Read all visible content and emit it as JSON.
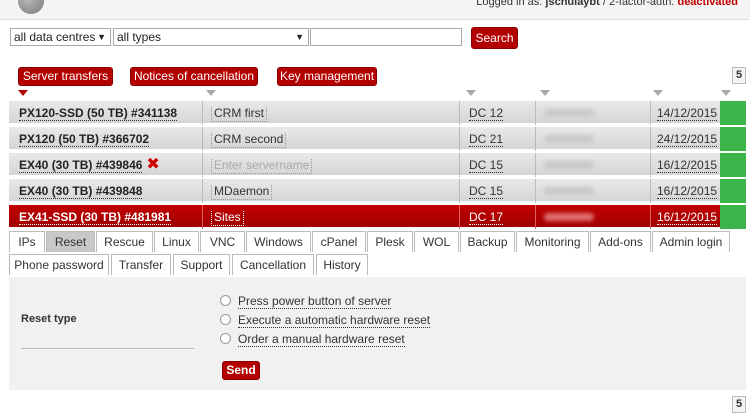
{
  "header": {
    "login_prefix": "Logged in as:",
    "username": "jschulaybt",
    "separator": " / 2-factor-auth: ",
    "two_factor_status": "deactivated"
  },
  "search": {
    "datacentre_select": "all data centres",
    "type_select": "all types",
    "query_value": "",
    "button_label": "Search"
  },
  "actions": {
    "server_transfers": "Server transfers",
    "notices_of_cancellation": "Notices of cancellation",
    "key_management": "Key management"
  },
  "result_count": "5",
  "servers": [
    {
      "name": "PX120-SSD (50 TB) #341138",
      "label": "CRM first",
      "dc": "DC 12",
      "date": "14/12/2015",
      "selected": false,
      "deletable": false
    },
    {
      "name": "PX120 (50 TB) #366702",
      "label": "CRM second",
      "dc": "DC 21",
      "date": "24/12/2015",
      "selected": false,
      "deletable": false
    },
    {
      "name": "EX40 (30 TB) #439846",
      "label": "",
      "label_placeholder": "Enter servername",
      "dc": "DC 15",
      "date": "16/12/2015",
      "selected": false,
      "deletable": true
    },
    {
      "name": "EX40 (30 TB) #439848",
      "label": "MDaemon",
      "dc": "DC 15",
      "date": "16/12/2015",
      "selected": false,
      "deletable": false
    },
    {
      "name": "EX41-SSD (30 TB) #481981",
      "label": "Sites",
      "dc": "DC 17",
      "date": "16/12/2015",
      "selected": true,
      "deletable": false
    }
  ],
  "tabs_row1": [
    "IPs",
    "Reset",
    "Rescue",
    "Linux",
    "VNC",
    "Windows",
    "cPanel",
    "Plesk",
    "WOL",
    "Backup",
    "Monitoring",
    "Add-ons",
    "Admin login"
  ],
  "tabs_row2": [
    "Phone password",
    "Transfer",
    "Support",
    "Cancellation",
    "History"
  ],
  "active_tab": "Reset",
  "reset_panel": {
    "title": "Reset type",
    "options": [
      "Press power button of server",
      "Execute a automatic hardware reset",
      "Order a manual hardware reset"
    ],
    "send_label": "Send"
  },
  "colors": {
    "accent": "#b30000",
    "status_ok": "#3bb54a"
  }
}
